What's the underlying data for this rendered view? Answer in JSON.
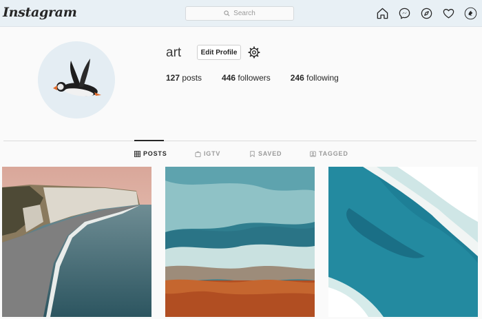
{
  "nav": {
    "logo": "Instagram",
    "search_placeholder": "Search",
    "icons": [
      "home-icon",
      "messenger-icon",
      "explore-icon",
      "heart-icon",
      "profile-avatar-icon"
    ]
  },
  "profile": {
    "username": "art",
    "edit_label": "Edit Profile",
    "stats": [
      {
        "count": "127",
        "label": " posts"
      },
      {
        "count": "446",
        "label": " followers"
      },
      {
        "count": "246",
        "label": " following"
      }
    ]
  },
  "tabs": [
    {
      "label": "POSTS",
      "icon": "grid-icon",
      "active": true
    },
    {
      "label": "IGTV",
      "icon": "igtv-icon",
      "active": false
    },
    {
      "label": "SAVED",
      "icon": "bookmark-icon",
      "active": false
    },
    {
      "label": "TAGGED",
      "icon": "tag-icon",
      "active": false
    }
  ],
  "colors": {
    "topbar": "#e8f0f5",
    "background": "#fafafa",
    "text": "#262626",
    "muted": "#9a9a9a",
    "sea": "#2d7f95"
  },
  "posts": [
    {
      "subject": "coastal cliffs at dusk"
    },
    {
      "subject": "aerial waves on orange sand"
    },
    {
      "subject": "aerial turquoise ocean waves"
    }
  ]
}
